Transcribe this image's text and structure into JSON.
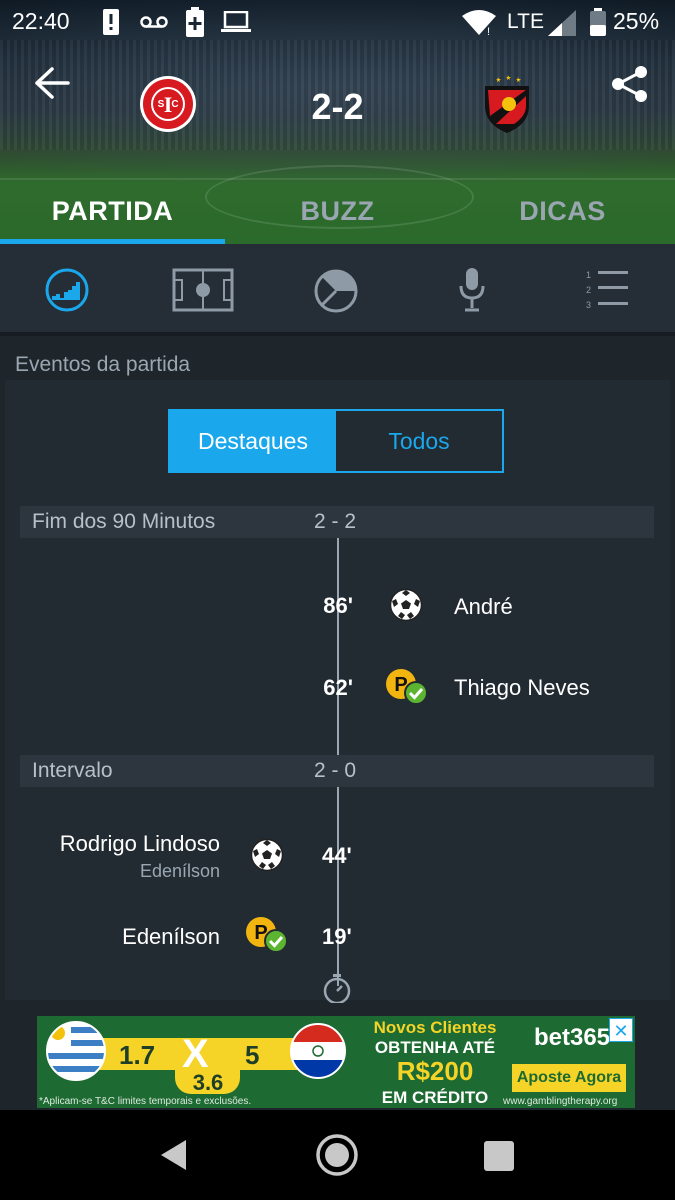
{
  "status_bar": {
    "time": "22:40",
    "network": "LTE",
    "battery": "25%",
    "icons": [
      "alert-icon",
      "voicemail-icon",
      "battery-saver-icon",
      "laptop-icon",
      "wifi-icon",
      "signal-icon",
      "battery-icon"
    ]
  },
  "header": {
    "score": "2-2",
    "home_team_logo": "internacional-crest",
    "away_team_logo": "sport-recife-crest"
  },
  "tabs": [
    {
      "label": "PARTIDA",
      "active": true
    },
    {
      "label": "BUZZ",
      "active": false
    },
    {
      "label": "DICAS",
      "active": false
    }
  ],
  "subnav_icons": [
    "stats-chart-icon",
    "pitch-icon",
    "pie-chart-icon",
    "microphone-icon",
    "lineup-list-icon"
  ],
  "events": {
    "section_title": "Eventos da partida",
    "toggle": {
      "highlights": "Destaques",
      "all": "Todos"
    },
    "periods": [
      {
        "label": "Fim dos 90 Minutos",
        "score": "2 - 2",
        "items": [
          {
            "minute": "86'",
            "side": "away",
            "icon": "ball-icon",
            "player": "André",
            "detail": ""
          },
          {
            "minute": "62'",
            "side": "away",
            "icon": "penalty-scored-icon",
            "player": "Thiago Neves",
            "detail": ""
          }
        ]
      },
      {
        "label": "Intervalo",
        "score": "2 - 0",
        "items": [
          {
            "minute": "44'",
            "side": "home",
            "icon": "ball-icon",
            "player": "Rodrigo Lindoso",
            "detail": "Edenílson"
          },
          {
            "minute": "19'",
            "side": "home",
            "icon": "penalty-scored-icon",
            "player": "Edenílson",
            "detail": ""
          }
        ]
      }
    ],
    "kickoff_icon": "stopwatch-icon"
  },
  "ad": {
    "odds_home": "1.7",
    "odds_draw": "3.6",
    "odds_away": "5",
    "draw_symbol": "X",
    "headline": "Novos Clientes",
    "line2": "OBTENHA ATÉ",
    "amount": "R$200",
    "line4": "EM CRÉDITO",
    "brand": "bet365",
    "cta": "Aposte Agora",
    "disclaimer": "*Aplicam-se T&C limites temporais e exclusões.",
    "url": "www.gamblingtherapy.org",
    "close": "✕"
  },
  "colors": {
    "accent": "#1aa7ec",
    "panel": "#232b32",
    "penalty_yellow": "#f2b50f",
    "check_green": "#5cb531"
  }
}
